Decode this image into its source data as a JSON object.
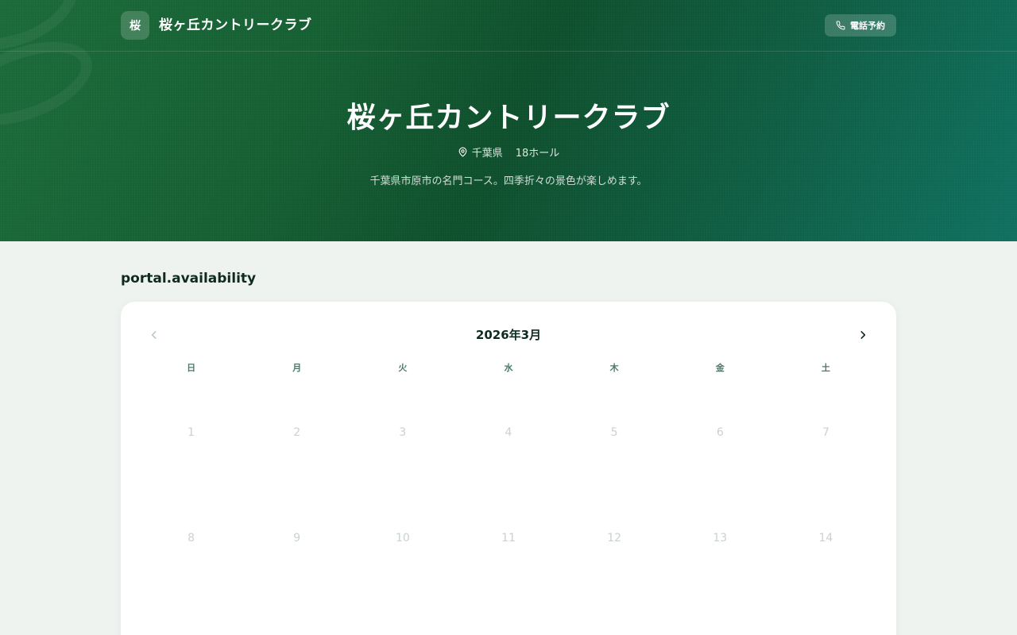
{
  "header": {
    "logo_char": "桜",
    "brand": "桜ヶ丘カントリークラブ",
    "phone_button_label": "電話予約",
    "phone_icon": "phone-icon"
  },
  "hero": {
    "title": "桜ヶ丘カントリークラブ",
    "location_icon": "map-pin-icon",
    "prefecture": "千葉県",
    "holes": "18ホール",
    "description": "千葉県市原市の名門コース。四季折々の景色が楽しめます。"
  },
  "availability": {
    "section_title": "portal.availability",
    "month_label": "2026年3月",
    "weekdays": [
      "日",
      "月",
      "火",
      "水",
      "木",
      "金",
      "土"
    ],
    "days": [
      "1",
      "2",
      "3",
      "4",
      "5",
      "6",
      "7",
      "8",
      "9",
      "10",
      "11",
      "12",
      "13",
      "14"
    ]
  },
  "colors": {
    "hero_gradient_start": "#1b6a38",
    "hero_gradient_end": "#0f7060",
    "page_background": "#eef3f0",
    "disabled_day": "#c9d2ce",
    "weekday_text": "#4b7a66"
  }
}
